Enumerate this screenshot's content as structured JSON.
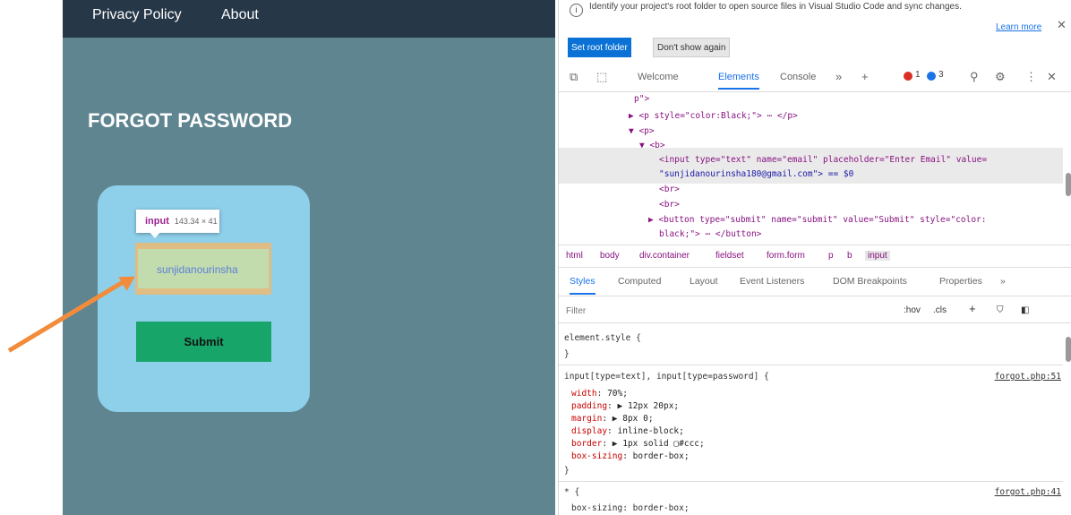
{
  "webpage": {
    "nav": [
      "Privacy Policy",
      "About"
    ],
    "title": "FORGOT PASSWORD",
    "tooltip": {
      "tag": "input",
      "dims": "143.34 × 41"
    },
    "email_value": "sunjidanourinsha",
    "submit_label": "Submit",
    "colors": {
      "navbar": "#263748",
      "page_bg": "#5f8591",
      "card": "#8ecfea",
      "submit": "#17a56a",
      "arrow": "#f28c3b"
    }
  },
  "devtools": {
    "banner": {
      "text": "Identify your project's root folder to open source files in Visual Studio Code and sync changes.",
      "learn_more": "Learn more",
      "set_root": "Set root folder",
      "dont_show": "Don't show again"
    },
    "tabs": {
      "welcome": "Welcome",
      "elements": "Elements",
      "console": "Console",
      "errors": "1",
      "messages": "3"
    },
    "dom": {
      "l0": "p\">",
      "l1_pre": "▶ <p style=\"color:Black;\">",
      "l1_post": "⋯ </p>",
      "l2": "▼ <p>",
      "l3": "▼ <b>",
      "l4_a": "<input type=\"text\" name=\"email\" placeholder=\"Enter Email\" value=",
      "l4_b": "\"sunjidanourinsha180@gmail.com\"> == $0",
      "l5": "<br>",
      "l6": "<br>",
      "l7_a": "▶ <button type=\"submit\" name=\"submit\" value=\"Submit\" style=\"color:",
      "l7_b": "black;\"> ⋯ </button>"
    },
    "breadcrumbs": [
      "html",
      "body",
      "div.container",
      "fieldset",
      "form.form",
      "p",
      "b",
      "input"
    ],
    "subtabs": [
      "Styles",
      "Computed",
      "Layout",
      "Event Listeners",
      "DOM Breakpoints",
      "Properties"
    ],
    "filter": {
      "placeholder": "Filter",
      "hov": ":hov",
      "cls": ".cls"
    },
    "styles": {
      "element_open": "element.style {",
      "close": "}",
      "rule_selector": "input[type=text], input[type=password] {",
      "rule_source": "forgot.php:51",
      "props": [
        {
          "name": "width",
          "value": "70%;"
        },
        {
          "name": "padding",
          "value": "▶ 12px 20px;"
        },
        {
          "name": "margin",
          "value": "▶ 8px 0;"
        },
        {
          "name": "display",
          "value": "inline-block;"
        },
        {
          "name": "border",
          "value": "▶ 1px solid ▢#ccc;"
        },
        {
          "name": "box-sizing",
          "value": "border-box;"
        }
      ],
      "universal_selector": "* {",
      "universal_source": "forgot.php:41",
      "universal_prop": "box-sizing: border-box;"
    }
  }
}
